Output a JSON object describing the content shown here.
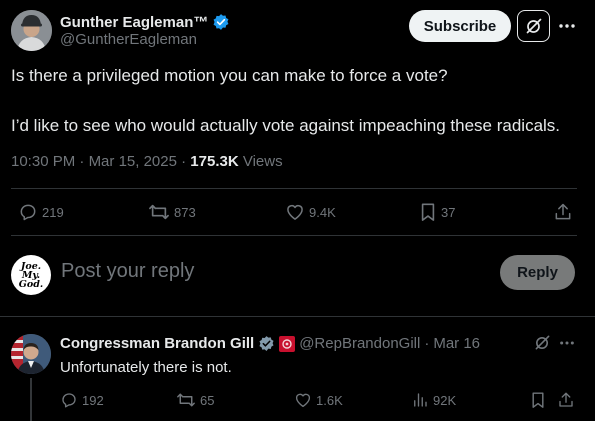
{
  "post": {
    "author_name": "Gunther Eagleman™",
    "author_handle": "@GuntherEagleman",
    "subscribe_label": "Subscribe",
    "text_line1": "Is there a privileged motion you can make to force a vote?",
    "text_line2": "I’d like to see who would actually vote against impeaching these radicals.",
    "time": "10:30 PM",
    "date": "Mar 15, 2025",
    "views_count": "175.3K",
    "views_label": "Views",
    "stats": {
      "replies": "219",
      "reposts": "873",
      "likes": "9.4K",
      "bookmarks": "37"
    }
  },
  "composer": {
    "avatar_text": [
      "Joe.",
      "My.",
      "God."
    ],
    "placeholder": "Post your reply",
    "reply_label": "Reply"
  },
  "reply": {
    "author_name": "Congressman Brandon Gill",
    "author_handle": "@RepBrandonGill",
    "date": "Mar 16",
    "text": "Unfortunately there is not.",
    "stats": {
      "replies": "192",
      "reposts": "65",
      "likes": "1.6K",
      "views": "92K"
    }
  },
  "colors": {
    "background": "#000000",
    "text_primary": "#e7e9ea",
    "text_secondary": "#71767b",
    "verified_blue": "#1d9bf0",
    "divider": "#2f3336",
    "gov_badge_red": "#c8102e"
  },
  "icons": [
    "verified-badge-icon",
    "grok-icon",
    "more-icon",
    "reply-icon",
    "repost-icon",
    "like-icon",
    "bookmark-icon",
    "share-icon",
    "analytics-icon",
    "government-badge-icon",
    "house-seal-icon"
  ]
}
